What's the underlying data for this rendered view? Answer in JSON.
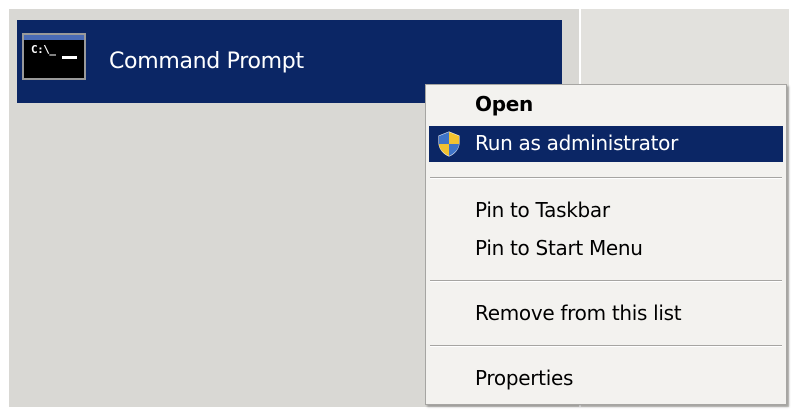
{
  "program": {
    "label": "Command Prompt",
    "icon": "command-prompt-icon",
    "icon_text": "C:\\_"
  },
  "context_menu": {
    "items": [
      {
        "label": "Open",
        "bold": true
      },
      {
        "label": "Run as administrator",
        "icon": "uac-shield-icon",
        "highlighted": true
      },
      {
        "label": "Pin to Taskbar"
      },
      {
        "label": "Pin to Start Menu"
      },
      {
        "label": "Remove from this list"
      },
      {
        "label": "Properties"
      }
    ]
  },
  "colors": {
    "selection": "#0b2665",
    "panel": "#d9d8d4",
    "menu_background": "#f3f2ef",
    "menu_border": "#a6a5a2"
  }
}
